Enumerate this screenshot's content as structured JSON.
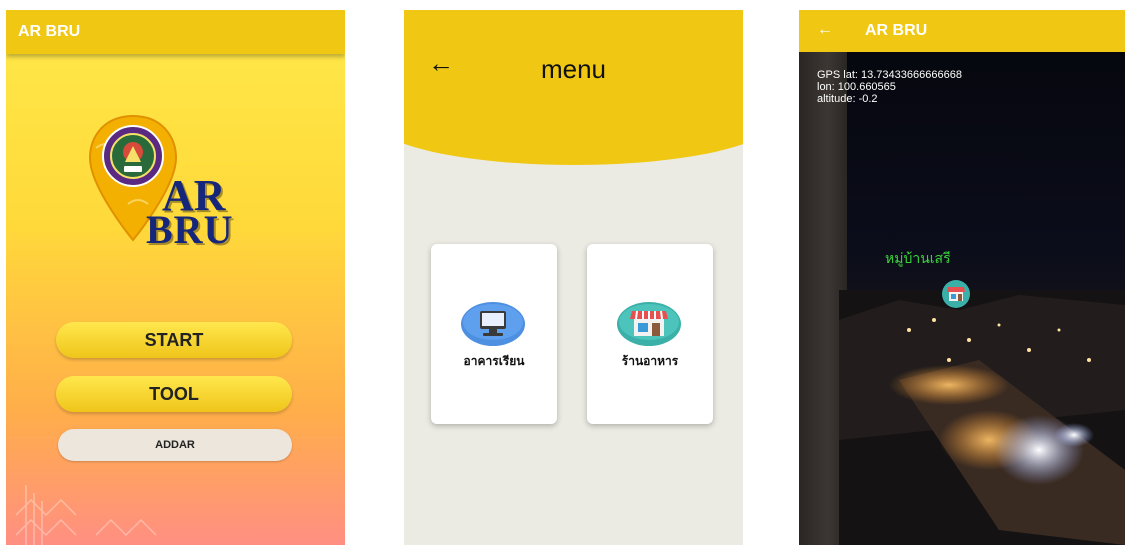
{
  "screen1": {
    "app_title": "AR BRU",
    "logo_line1": "AR",
    "logo_line2": "BRU",
    "buttons": {
      "start": "START",
      "tool": "TOOL",
      "addar": "ADDAR"
    },
    "colors": {
      "appbar": "#f0c814",
      "button": "#f5d321",
      "logo_text": "#16267a"
    }
  },
  "screen2": {
    "title": "menu",
    "back_icon": "left-arrow-icon",
    "cards": [
      {
        "label": "อาคารเรียน",
        "icon": "computer-icon"
      },
      {
        "label": "ร้านอาหาร",
        "icon": "store-icon"
      }
    ]
  },
  "screen3": {
    "app_title": "AR BRU",
    "back_icon": "left-arrow-icon",
    "gps_lines": [
      "GPS lat: 13.73433666666668",
      "lon: 100.660565",
      "altitude: -0.2"
    ],
    "poi_label": "หมู่บ้านเสรี",
    "poi_icon": "store-icon",
    "colors": {
      "poi_label": "#3ad43a"
    }
  }
}
